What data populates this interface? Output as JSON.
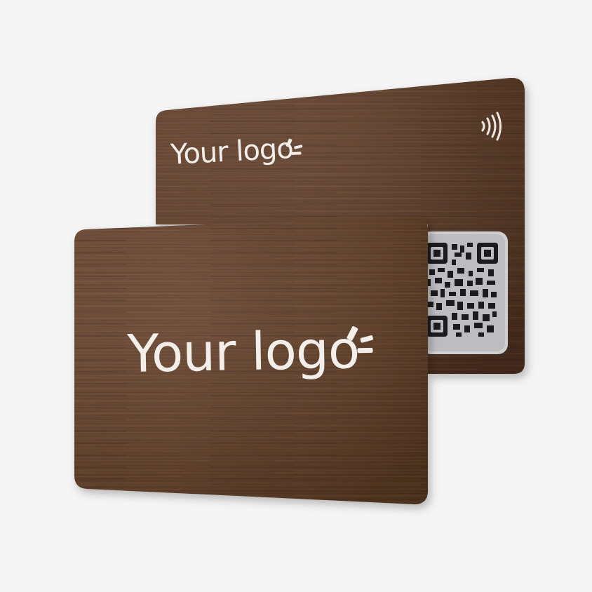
{
  "back_card": {
    "logo_text": "Your logo",
    "has_nfc_icon": true,
    "has_qr_code": true
  },
  "front_card": {
    "logo_text": "Your logo"
  },
  "icons": [
    "logo-mark-icon",
    "nfc-contactless-icon",
    "qr-code-icon"
  ],
  "colors": {
    "background": "#f5f5f6",
    "wood_base": "#6b4630",
    "wood_dark": "#4e301f",
    "logo_text": "#f3eee9",
    "qr_panel": "#c9c9cb"
  }
}
